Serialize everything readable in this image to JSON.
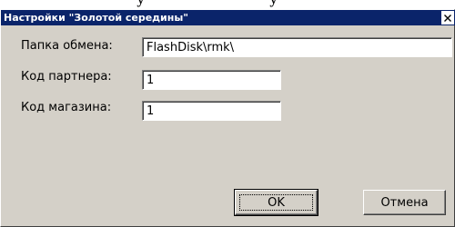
{
  "dialog": {
    "title": "Настройки \"Золотой середины\"",
    "close_glyph": "×"
  },
  "fields": [
    {
      "label": "Папка обмена:",
      "value": "FlashDisk\\rmk\\"
    },
    {
      "label": "Код партнера:",
      "value": "1"
    },
    {
      "label": "Код магазина:",
      "value": "1"
    }
  ],
  "buttons": {
    "ok": "OK",
    "cancel": "Отмена"
  },
  "colors": {
    "titlebar": "#0a246a",
    "face": "#d4d0c8"
  },
  "icons": {
    "close": "close-icon"
  }
}
